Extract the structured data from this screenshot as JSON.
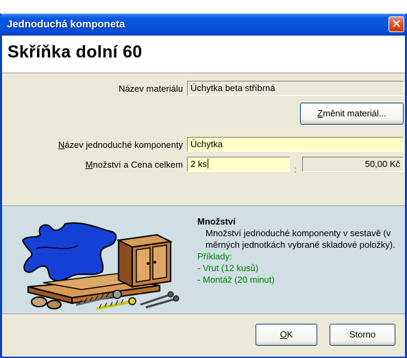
{
  "window": {
    "title": "Jednoduchá komponeta",
    "close_glyph": "✕"
  },
  "header": {
    "title": "Skříňka dolní 60"
  },
  "form": {
    "material_label": "Název materiálu",
    "material_value": "Úchytka beta stříbrná",
    "change_material_prefix": "Z",
    "change_material_rest": "měnit materiál...",
    "component_label_prefix": "N",
    "component_label_rest": "ázev jednoduché komponenty",
    "component_value": "Úchytka",
    "qty_label_prefix": "M",
    "qty_label_rest": "nožství a Cena celkem",
    "qty_value": "2 ks",
    "separator": ":",
    "price_value": "50,00 Kč"
  },
  "help": {
    "heading": "Množství",
    "description": "Množství jednoduché komponenty v sestavě (v měrných jednotkách vybrané skladové položky).",
    "examples_title": "Příklady:",
    "example_1": "- Vrut (12 kusů)",
    "example_2": "- Montáž (20 minut)"
  },
  "buttons": {
    "ok_prefix": "O",
    "ok_rest": "K",
    "cancel": "Storno"
  },
  "colors": {
    "titlebar": "#0453dc",
    "editable_field": "#ffffc7",
    "help_panel": "#cfdfe4",
    "help_examples": "#008000"
  },
  "icons": {
    "help_illustration": "puzzle-furniture-tools-illustration"
  }
}
